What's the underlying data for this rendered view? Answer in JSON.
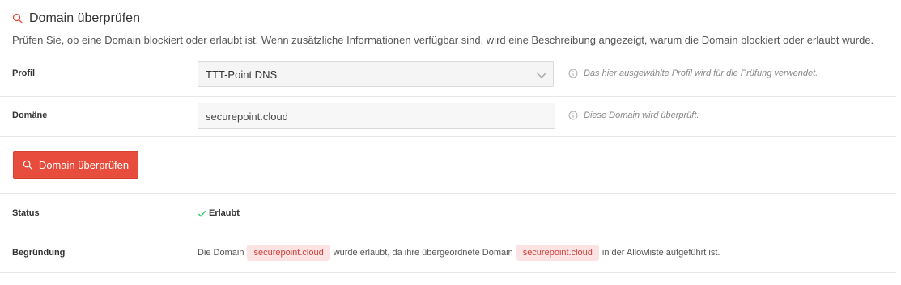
{
  "header": {
    "title": "Domain überprüfen",
    "description": "Prüfen Sie, ob eine Domain blockiert oder erlaubt ist. Wenn zusätzliche Informationen verfügbar sind, wird eine Beschreibung angezeigt, warum die Domain blockiert oder erlaubt wurde.",
    "icon": "search-icon",
    "accent_color": "#e74c3c"
  },
  "form": {
    "profile": {
      "label": "Profil",
      "selected": "TTT-Point DNS",
      "hint": "Das hier ausgewählte Profil wird für die Prüfung verwendet."
    },
    "domain": {
      "label": "Domäne",
      "value": "securepoint.cloud",
      "hint": "Diese Domain wird überprüft."
    },
    "submit_label": "Domain überprüfen"
  },
  "result": {
    "status_label": "Status",
    "status_value": "Erlaubt",
    "status_color": "#2ecc71",
    "reason_label": "Begründung",
    "reason_prefix": "Die Domain",
    "reason_domain": "securepoint.cloud",
    "reason_middle": "wurde erlaubt, da ihre übergeordnete Domain",
    "reason_parent_domain": "securepoint.cloud",
    "reason_suffix": "in der Allowliste aufgeführt ist."
  }
}
